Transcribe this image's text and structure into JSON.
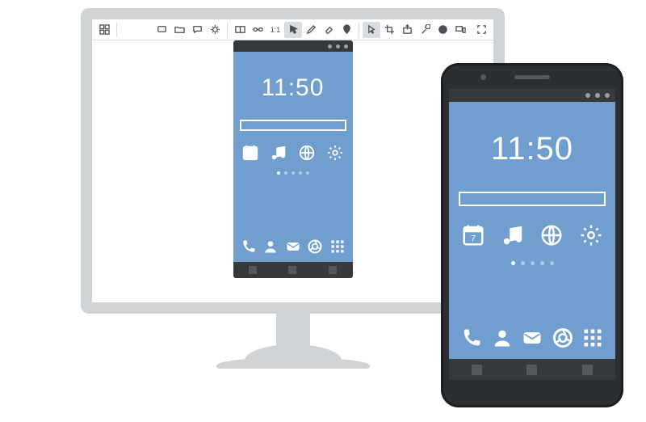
{
  "toolbar": {
    "grid_label": "grid",
    "ratio_label": "1:1",
    "groups": [
      [
        "device",
        "folder",
        "chat",
        "sun"
      ],
      [
        "layout-h",
        "layout-v",
        "ratio",
        "pointer",
        "pencil",
        "eraser",
        "pin"
      ],
      [
        "cursor",
        "crop",
        "share",
        "sliders",
        "target",
        "mirror"
      ]
    ]
  },
  "clock": {
    "time": "11:50"
  },
  "homescreen": {
    "calendar_day": "7",
    "app_icons": [
      "calendar",
      "music",
      "globe",
      "settings"
    ],
    "dots_count": 5,
    "dots_active_index": 0,
    "dock_icons": [
      "phone",
      "contact",
      "mail",
      "browser",
      "apps"
    ]
  },
  "phone_statusbar_dots": 3,
  "nav_buttons": 3
}
